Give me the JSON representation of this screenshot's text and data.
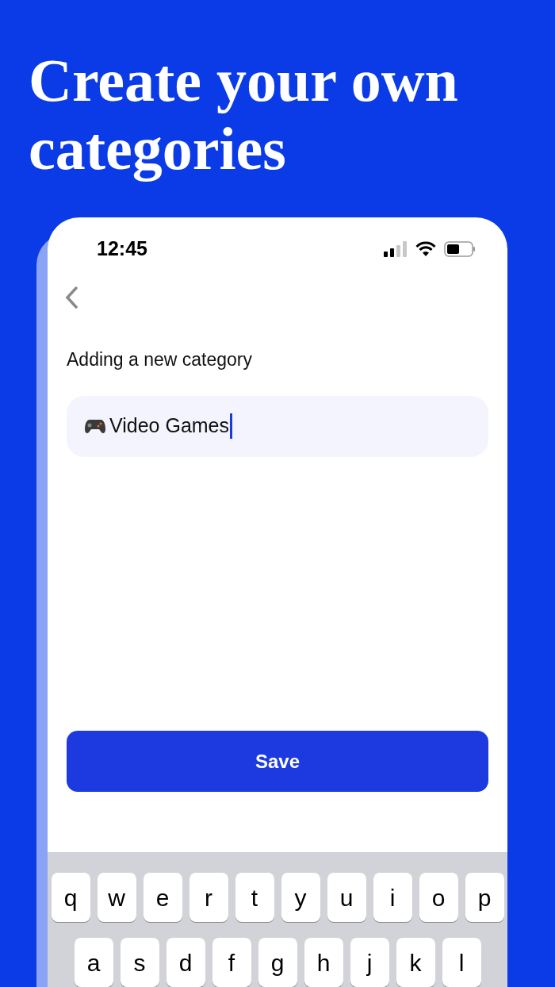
{
  "headline": "Create your own categories",
  "status_bar": {
    "time": "12:45"
  },
  "heading": "Adding a new category",
  "name_field": {
    "value": "Video Games",
    "focused": true
  },
  "save_button": "Save",
  "keyboard": {
    "rows": [
      [
        "q",
        "w",
        "e",
        "r",
        "t",
        "y",
        "u",
        "i",
        "o",
        "p"
      ],
      [
        "a",
        "s",
        "d",
        "f",
        "g",
        "h",
        "j",
        "k",
        "l"
      ]
    ]
  }
}
